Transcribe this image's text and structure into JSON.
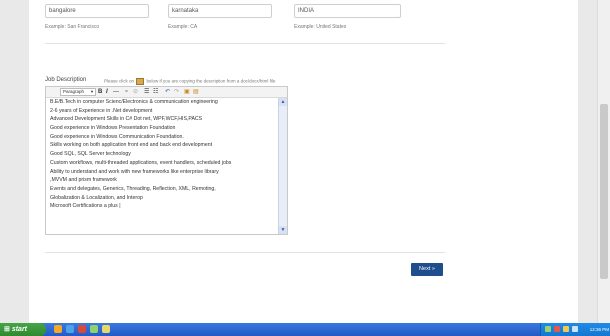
{
  "address": {
    "city_value": "bangalore",
    "state_value": "karnataka",
    "country_value": "INDIA",
    "city_hint": "Example: San Francisco",
    "state_hint": "Example: CA",
    "country_hint": "Example: United States"
  },
  "job_description": {
    "label": "Job Description",
    "note_prefix": "Please click on",
    "note_suffix": "below if you are copying the description from a doc/docx/html file",
    "format_select": "Paragraph",
    "lines": [
      "B.E/B.Tech in computer Scienc/Electronics & communication engineering",
      "2-6 years of Experience in .Net development",
      "Advanced Development Skills in C# Dot net, WPF,WCF,HIS,PACS",
      "Good experience in Windows Presentation Foundation",
      "Good experience in Windows Communication Foundation.",
      "Skills working on both application front end and back end development",
      "Good SQL, SQL Server technology",
      "Custom workflows, multi-threaded applications, event handlers, scheduled jobs",
      "Ability to understand and work with new frameworks like enterprise library",
      ",MVVM and prism framework",
      "Events and delegates, Generics, Threading, Reflection, XML, Remoting,",
      "Globalization & Localization, and Interop",
      "Microsoft Certifications a plus |"
    ]
  },
  "actions": {
    "next_label": "Next »"
  },
  "taskbar": {
    "start_label": "start",
    "clock": "12:36 PM"
  }
}
